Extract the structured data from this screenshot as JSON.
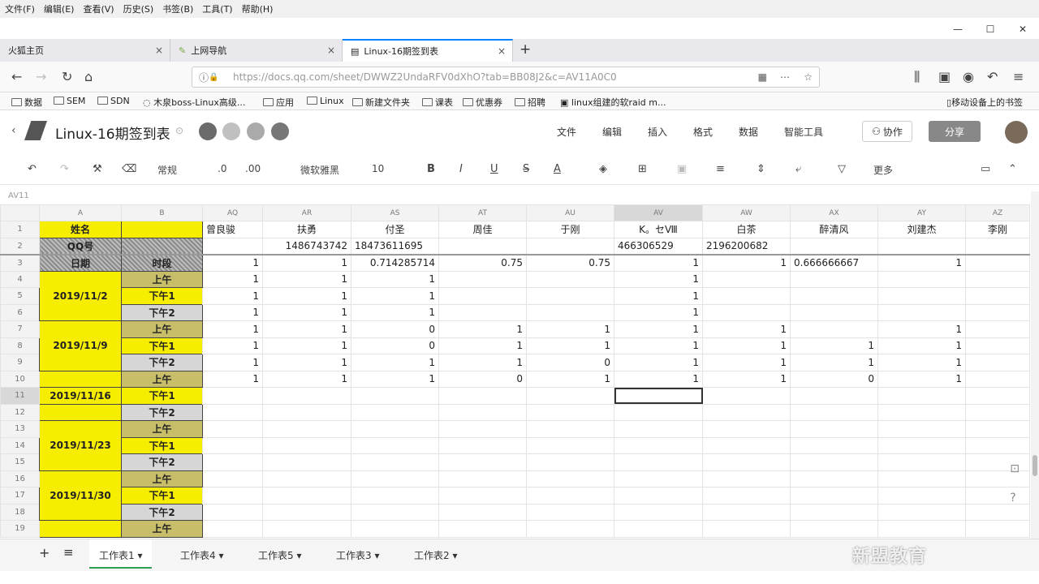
{
  "menubar": [
    "文件(F)",
    "编辑(E)",
    "查看(V)",
    "历史(S)",
    "书签(B)",
    "工具(T)",
    "帮助(H)"
  ],
  "window_controls": {
    "minimize": "—",
    "maximize": "☐",
    "close": "✕"
  },
  "tabs": [
    {
      "label": "火狐主页",
      "close": "×"
    },
    {
      "label": "上网导航",
      "close": "×"
    },
    {
      "label": "Linux-16期签到表",
      "close": "×"
    }
  ],
  "new_tab": "+",
  "url": "https://docs.qq.com/sheet/DWWZ2UndaRFV0dXhO?tab=BB08J2&c=AV11A0C0",
  "bookmarks": [
    "数据",
    "SEM",
    "SDN",
    "木泉boss-Linux高级...",
    "应用",
    "Linux",
    "新建文件夹",
    "课表",
    "优惠券",
    "招聘",
    "linux组建的软raid m...",
    "移动设备上的书签"
  ],
  "doc": {
    "title": "Linux-16期签到表",
    "menu": [
      "文件",
      "编辑",
      "插入",
      "格式",
      "数据",
      "智能工具"
    ],
    "collab": "协作",
    "share": "分享"
  },
  "toolbar": {
    "format": "常规",
    "dec_minus": ".0",
    "dec_plus": ".00",
    "font": "微软雅黑",
    "size": "10",
    "more": "更多"
  },
  "cell_ref": "AV11",
  "columns": [
    "A",
    "B",
    "AQ",
    "AR",
    "AS",
    "AT",
    "AU",
    "AV",
    "AW",
    "AX",
    "AY",
    "AZ"
  ],
  "row_numbers": [
    "1",
    "2",
    "3",
    "4",
    "5",
    "6",
    "7",
    "8",
    "9",
    "10",
    "11",
    "12",
    "13",
    "14",
    "15",
    "16",
    "17",
    "18",
    "19"
  ],
  "labels": {
    "name": "姓名",
    "qq": "QQ号",
    "date": "日期",
    "session": "时段",
    "am": "上午",
    "pm1": "下午1",
    "pm2": "下午2"
  },
  "dates": [
    "2019/11/2",
    "2019/11/9",
    "2019/11/16",
    "2019/11/23",
    "2019/11/30"
  ],
  "names": [
    "曾良骏",
    "扶勇",
    "付圣",
    "周佳",
    "于刚",
    "K。セⅧ",
    "白茶",
    "醉清风",
    "刘建杰",
    "李刚"
  ],
  "qq": [
    "",
    "1486743742",
    "18473611695",
    "",
    "",
    "466306529",
    "2196200682",
    "",
    "",
    ""
  ],
  "rates": [
    "1",
    "1",
    "0.714285714",
    "0.75",
    "0.75",
    "1",
    "1",
    "0.666666667",
    "1",
    ""
  ],
  "attendance": [
    [
      "1",
      "1",
      "1",
      "",
      "",
      "1",
      "",
      "",
      "",
      ""
    ],
    [
      "1",
      "1",
      "1",
      "",
      "",
      "1",
      "",
      "",
      "",
      ""
    ],
    [
      "1",
      "1",
      "1",
      "",
      "",
      "1",
      "",
      "",
      "",
      ""
    ],
    [
      "1",
      "1",
      "0",
      "1",
      "1",
      "1",
      "1",
      "",
      "1",
      ""
    ],
    [
      "1",
      "1",
      "0",
      "1",
      "1",
      "1",
      "1",
      "1",
      "1",
      ""
    ],
    [
      "1",
      "1",
      "1",
      "1",
      "0",
      "1",
      "1",
      "1",
      "1",
      ""
    ],
    [
      "1",
      "1",
      "1",
      "0",
      "1",
      "1",
      "1",
      "0",
      "1",
      ""
    ]
  ],
  "sheet_tabs": [
    "工作表1",
    "工作表4",
    "工作表5",
    "工作表3",
    "工作表2"
  ],
  "watermark": "新盟教育"
}
